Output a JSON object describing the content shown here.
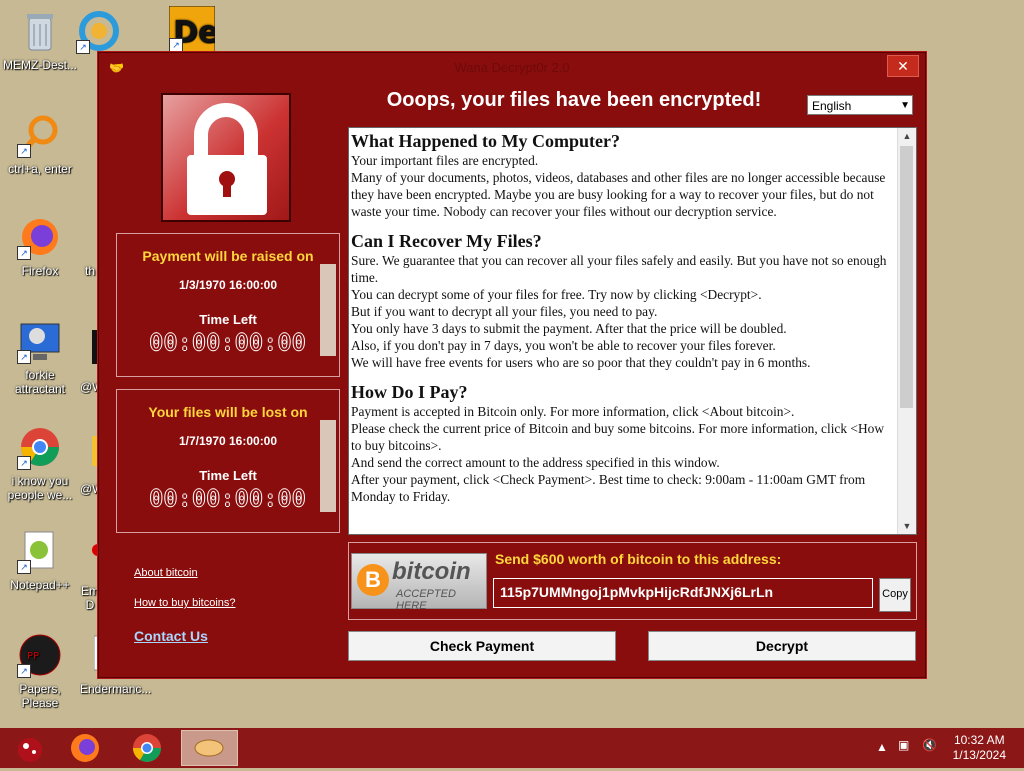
{
  "desktop": {
    "icons": [
      {
        "label": "MEMZ-Dest..."
      },
      {
        "label": "ctrl+a, enter"
      },
      {
        "label": "Firefox"
      },
      {
        "label": "forkie attractant"
      },
      {
        "label": "i know you people we..."
      },
      {
        "label": "Notepad++"
      },
      {
        "label": "Papers, Please"
      },
      {
        "label": "Endermanc..."
      },
      {
        "label": "Em D"
      },
      {
        "label": "@W"
      },
      {
        "label": "@W"
      },
      {
        "label": "th"
      }
    ]
  },
  "window": {
    "title": "Wana Decrypt0r 2.0",
    "headline": "Ooops, your files have been encrypted!",
    "language": "English",
    "panel1": {
      "heading": "Payment will be raised on",
      "date": "1/3/1970 16:00:00",
      "time_left_label": "Time Left",
      "timer": "00:00:00:00"
    },
    "panel2": {
      "heading": "Your files will be lost on",
      "date": "1/7/1970 16:00:00",
      "time_left_label": "Time Left",
      "timer": "00:00:00:00"
    },
    "links": {
      "about_bitcoin": "About bitcoin",
      "how_to_buy": "How to buy bitcoins?",
      "contact_us": "Contact Us"
    },
    "text": {
      "h1": "What Happened to My Computer?",
      "p1a": "Your important files are encrypted.",
      "p1b": "Many of your documents, photos, videos, databases and other files are no longer accessible because they have been encrypted. Maybe you are busy looking for a way to recover your files, but do not waste your time. Nobody can recover your files without our decryption service.",
      "h2": "Can I Recover My Files?",
      "p2a": "Sure. We guarantee that you can recover all your files safely and easily. But you have not so enough time.",
      "p2b": "You can decrypt some of your files for free. Try now by clicking <Decrypt>.",
      "p2c": "But if you want to decrypt all your files, you need to pay.",
      "p2d": "You only have 3 days to submit the payment. After that the price will be doubled.",
      "p2e": "Also, if you don't pay in 7 days, you won't be able to recover your files forever.",
      "p2f": "We will have free events for users who are so poor that they couldn't pay in 6 months.",
      "h3": "How Do I Pay?",
      "p3a": "Payment is accepted in Bitcoin only. For more information, click <About bitcoin>.",
      "p3b": "Please check the current price of Bitcoin and buy some bitcoins. For more information, click <How to buy bitcoins>.",
      "p3c": "And send the correct amount to the address specified in this window.",
      "p3d": "After your payment, click <Check Payment>. Best time to check: 9:00am - 11:00am GMT from Monday to Friday."
    },
    "bitcoin": {
      "logo_word": "bitcoin",
      "logo_sub": "ACCEPTED HERE",
      "send_label": "Send $600 worth of bitcoin to this address:",
      "address": "115p7UMMngoj1pMvkpHijcRdfJNXj6LrLn",
      "copy_label": "Copy"
    },
    "buttons": {
      "check_payment": "Check Payment",
      "decrypt": "Decrypt"
    }
  },
  "taskbar": {
    "clock_time": "10:32 AM",
    "clock_date": "1/13/2024"
  }
}
